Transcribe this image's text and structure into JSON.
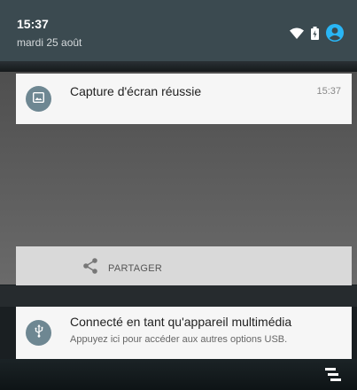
{
  "status": {
    "time": "15:37",
    "date": "mardi 25 août"
  },
  "screenshot_notification": {
    "title": "Capture d'écran réussie",
    "time": "15:37",
    "share_label": "PARTAGER"
  },
  "usb_notification": {
    "title": "Connecté en tant qu'appareil multimédia",
    "subtitle": "Appuyez ici pour accéder aux autres options USB."
  },
  "icons": {
    "wifi": "wifi-icon",
    "battery": "battery-charging-icon",
    "account": "account-icon",
    "image": "image-icon",
    "share": "share-icon",
    "usb": "usb-icon",
    "clear_all": "clear-all-icon"
  },
  "colors": {
    "accent": "#29b6f6",
    "header": "#3b4a50",
    "badge": "#6e8792"
  }
}
